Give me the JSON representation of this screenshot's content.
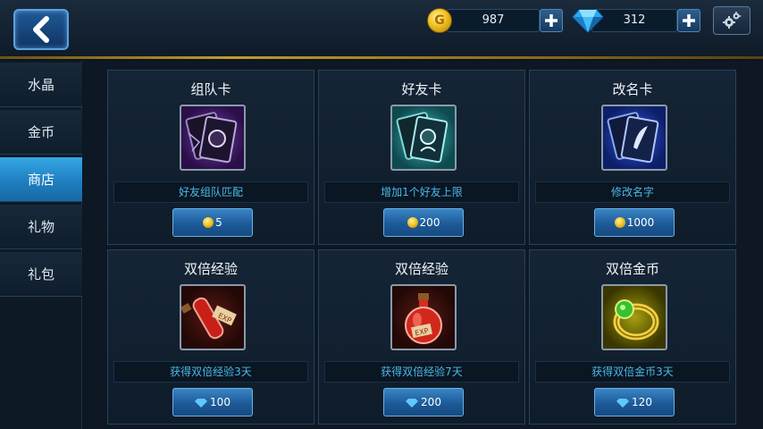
{
  "header": {
    "coins": "987",
    "gems": "312",
    "coin_glyph": "G"
  },
  "sidebar": {
    "tabs": [
      {
        "label": "水晶"
      },
      {
        "label": "金币"
      },
      {
        "label": "商店",
        "active": true
      },
      {
        "label": "礼物"
      },
      {
        "label": "礼包"
      }
    ]
  },
  "shop": {
    "items": [
      {
        "title": "组队卡",
        "desc": "好友组队匹配",
        "price": "5",
        "currency": "coin",
        "icon": "team-card-icon"
      },
      {
        "title": "好友卡",
        "desc": "增加1个好友上限",
        "price": "200",
        "currency": "coin",
        "icon": "friend-card-icon"
      },
      {
        "title": "改名卡",
        "desc": "修改名字",
        "price": "1000",
        "currency": "coin",
        "icon": "rename-card-icon"
      },
      {
        "title": "双倍经验",
        "desc": "获得双倍经验3天",
        "price": "100",
        "currency": "gem",
        "icon": "exp-vial-icon"
      },
      {
        "title": "双倍经验",
        "desc": "获得双倍经验7天",
        "price": "200",
        "currency": "gem",
        "icon": "exp-flask-icon"
      },
      {
        "title": "双倍金币",
        "desc": "获得双倍金币3天",
        "price": "120",
        "currency": "gem",
        "icon": "gold-ring-icon"
      }
    ]
  },
  "colors": {
    "accent": "#2f9ee0",
    "desc_text": "#4ab8ea",
    "gold_bar": "#c49a2a"
  }
}
